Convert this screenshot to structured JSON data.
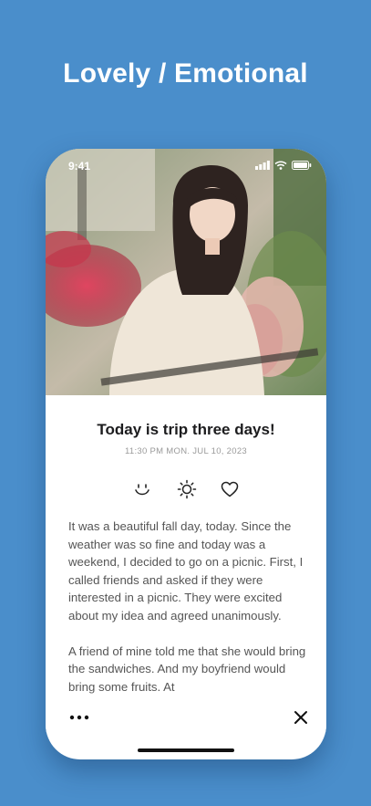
{
  "headline": "Lovely / Emotional",
  "status_bar": {
    "time": "9:41"
  },
  "entry": {
    "title": "Today is trip three days!",
    "datetime": "11:30 PM  MON. JUL 10, 2023",
    "mood_icons": [
      "smile-icon",
      "sun-icon",
      "heart-icon"
    ],
    "paragraphs": [
      "It was a beautiful fall day, today. Since the weather was so fine and today was a weekend, I decided to go on a picnic. First, I called friends and asked if they were interested in a picnic. They were excited about my idea and agreed unanimously.",
      "A friend of mine told me that she would bring the sandwiches. And my boyfriend would bring some fruits. At"
    ]
  },
  "toolbar": {
    "more_icon": "more-icon",
    "close_icon": "close-icon"
  },
  "colors": {
    "background": "#4a8ecb",
    "card": "#ffffff",
    "title_text": "#1c1c1e",
    "body_text": "#555555"
  }
}
